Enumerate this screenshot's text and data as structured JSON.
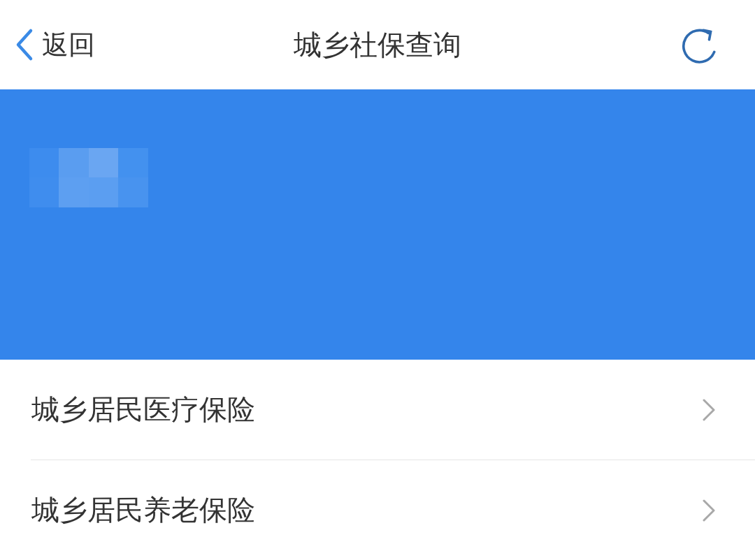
{
  "nav_bar": {
    "back_label": "返回",
    "title": "城乡社保查询"
  },
  "list": [
    {
      "label": "城乡居民医疗保险"
    },
    {
      "label": "城乡居民养老保险"
    }
  ]
}
